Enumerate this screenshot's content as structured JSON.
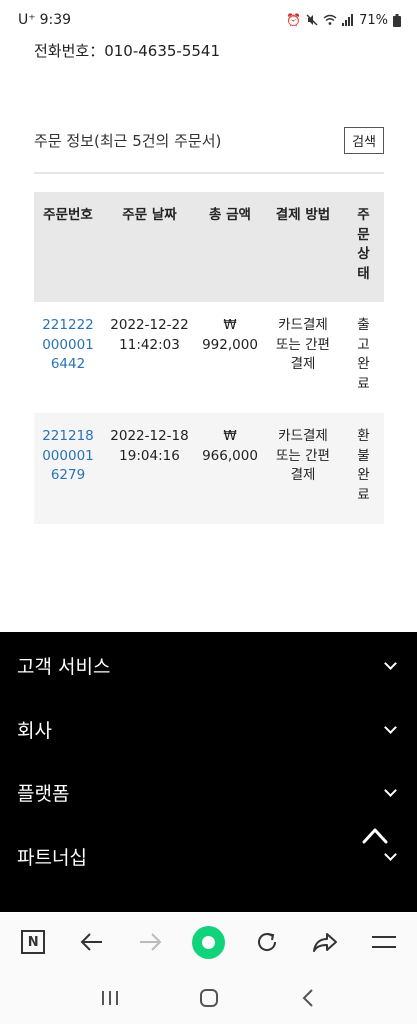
{
  "status_bar": {
    "carrier": "U⁺",
    "time": "9:39",
    "battery": "71%"
  },
  "phone_line": "전화번호：010-4635-5541",
  "orders": {
    "title": "주문 정보(최근 5건의 주문서)",
    "search_label": "검색",
    "headers": {
      "order_no": "주문번호",
      "order_date": "주문 날짜",
      "total": "총 금액",
      "payment": "결제 방법",
      "status": "주문상태"
    },
    "rows": [
      {
        "order_no": "2212220000016442",
        "date": "2022-12-22",
        "time": "11:42:03",
        "currency": "₩",
        "amount": "992,000",
        "payment": "카드결제 또는 간편결제",
        "status": "출고완료"
      },
      {
        "order_no": "2212180000016279",
        "date": "2022-12-18",
        "time": "19:04:16",
        "currency": "₩",
        "amount": "966,000",
        "payment": "카드결제 또는 간편결제",
        "status": "환불완료"
      }
    ]
  },
  "footer": {
    "items": [
      "고객 서비스",
      "회사",
      "플랫폼",
      "파트너십"
    ]
  },
  "colors": {
    "link": "#2a73b8",
    "header_bg": "#e8e8e8",
    "footer_bg": "#000000",
    "accent_green": "#10d37a"
  }
}
